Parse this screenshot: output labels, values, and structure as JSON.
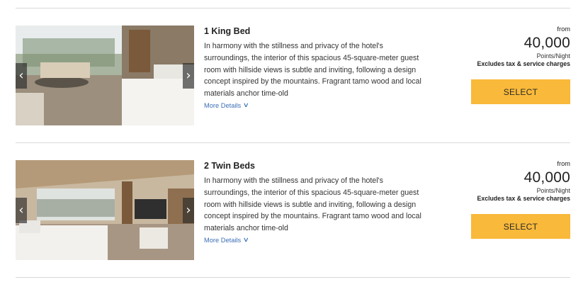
{
  "rooms": [
    {
      "title": "1 King Bed",
      "description": "In harmony with the stillness and privacy of the hotel's surroundings, the interior of this spacious 45-square-meter guest room with hillside views is subtle and inviting, following a design concept inspired by the mountains. Fragrant tamo wood and local materials anchor time-old",
      "more_details": "More Details",
      "from_label": "from",
      "points": "40,000",
      "unit": "Points/Night",
      "tax_note": "Excludes tax & service charges",
      "select_label": "SELECT"
    },
    {
      "title": "2 Twin Beds",
      "description": "In harmony with the stillness and privacy of the hotel's surroundings, the interior of this spacious 45-square-meter guest room with hillside views is subtle and inviting, following a design concept inspired by the mountains. Fragrant tamo wood and local materials anchor time-old",
      "more_details": "More Details",
      "from_label": "from",
      "points": "40,000",
      "unit": "Points/Night",
      "tax_note": "Excludes tax & service charges",
      "select_label": "SELECT"
    }
  ],
  "icons": {
    "prev": "chevron-left-icon",
    "next": "chevron-right-icon",
    "more": "chevron-down-icon"
  },
  "colors": {
    "select_button": "#f9b93a",
    "link": "#3b6fb6",
    "divider": "#d9d9d9"
  }
}
